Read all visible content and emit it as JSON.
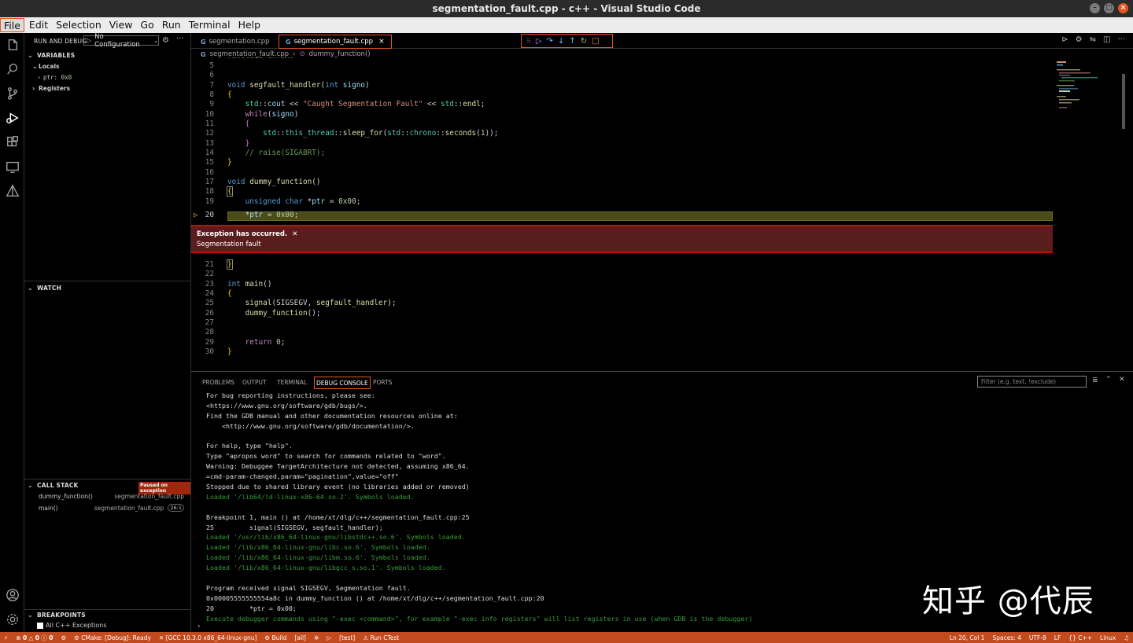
{
  "window": {
    "title": "segmentation_fault.cpp - c++ - Visual Studio Code"
  },
  "menu": [
    "File",
    "Edit",
    "Selection",
    "View",
    "Go",
    "Run",
    "Terminal",
    "Help"
  ],
  "sidebar": {
    "header": "RUN AND DEBUG",
    "config": "No Configuration",
    "variables": {
      "title": "VARIABLES",
      "locals": "Locals",
      "ptr_name": "ptr:",
      "ptr_value": "0x0",
      "registers": "Registers"
    },
    "watch": {
      "title": "WATCH"
    },
    "callstack": {
      "title": "CALL STACK",
      "badge": "Paused on exception",
      "frames": [
        {
          "fn": "dummy_function()",
          "file": "segmentation_fault.cpp",
          "pos": ""
        },
        {
          "fn": "main()",
          "file": "segmentation_fault.cpp",
          "pos": "26:1"
        }
      ]
    },
    "breakpoints": {
      "title": "BREAKPOINTS",
      "item": "All C++ Exceptions"
    }
  },
  "tabs": [
    {
      "label": "segmentation.cpp",
      "icon": "G"
    },
    {
      "label": "segmentation_fault.cpp",
      "icon": "G"
    }
  ],
  "breadcrumb": {
    "file": "segmentation_fault.cpp",
    "symbol": "dummy_function()"
  },
  "exception": {
    "title": "Exception has occurred.",
    "message": "Segmentation fault"
  },
  "panel": {
    "tabs": [
      "PROBLEMS",
      "OUTPUT",
      "TERMINAL",
      "DEBUG CONSOLE",
      "PORTS"
    ],
    "filter_placeholder": "Filter (e.g. text, !exclude)",
    "console": [
      {
        "t": "For bug reporting instructions, please see:",
        "g": false
      },
      {
        "t": "<https://www.gnu.org/software/gdb/bugs/>.",
        "g": false
      },
      {
        "t": "Find the GDB manual and other documentation resources online at:",
        "g": false
      },
      {
        "t": "    <http://www.gnu.org/software/gdb/documentation/>.",
        "g": false
      },
      {
        "t": "",
        "g": false
      },
      {
        "t": "For help, type \"help\".",
        "g": false
      },
      {
        "t": "Type \"apropos word\" to search for commands related to \"word\".",
        "g": false
      },
      {
        "t": "Warning: Debuggee TargetArchitecture not detected, assuming x86_64.",
        "g": false
      },
      {
        "t": "=cmd-param-changed,param=\"pagination\",value=\"off\"",
        "g": false
      },
      {
        "t": "Stopped due to shared library event (no libraries added or removed)",
        "g": false
      },
      {
        "t": "Loaded '/lib64/ld-linux-x86-64.so.2'. Symbols loaded.",
        "g": true
      },
      {
        "t": "",
        "g": false
      },
      {
        "t": "Breakpoint 1, main () at /home/xt/dlg/c++/segmentation_fault.cpp:25",
        "g": false
      },
      {
        "t": "25         signal(SIGSEGV, segfault_handler);",
        "g": false
      },
      {
        "t": "Loaded '/usr/lib/x86_64-linux-gnu/libstdc++.so.6'. Symbols loaded.",
        "g": true
      },
      {
        "t": "Loaded '/lib/x86_64-linux-gnu/libc.so.6'. Symbols loaded.",
        "g": true
      },
      {
        "t": "Loaded '/lib/x86_64-linux-gnu/libm.so.6'. Symbols loaded.",
        "g": true
      },
      {
        "t": "Loaded '/lib/x86_64-linux-gnu/libgcc_s.so.1'. Symbols loaded.",
        "g": true
      },
      {
        "t": "",
        "g": false
      },
      {
        "t": "Program received signal SIGSEGV, Segmentation fault.",
        "g": false
      },
      {
        "t": "0x00005555555554a8c in dummy_function () at /home/xt/dlg/c++/segmentation_fault.cpp:20",
        "g": false
      },
      {
        "t": "20         *ptr = 0x00;",
        "g": false
      },
      {
        "t": "Execute debugger commands using \"-exec <command>\", for example \"-exec info registers\" will list registers in use (when GDB is the debugger)",
        "g": true
      }
    ]
  },
  "status": {
    "errors": "0",
    "warnings": "0",
    "infos": "0",
    "cmake": "CMake: [Debug]: Ready",
    "kit": "[GCC 10.3.0 x86_64-linux-gnu]",
    "build": "Build",
    "all": "[all]",
    "test": "[test]",
    "ctest": "Run CTest",
    "position": "Ln 20, Col 1",
    "spaces": "Spaces: 4",
    "encoding": "UTF-8",
    "eol": "LF",
    "lang": "C++",
    "os": "Linux"
  },
  "watermark": "知乎 @代辰"
}
